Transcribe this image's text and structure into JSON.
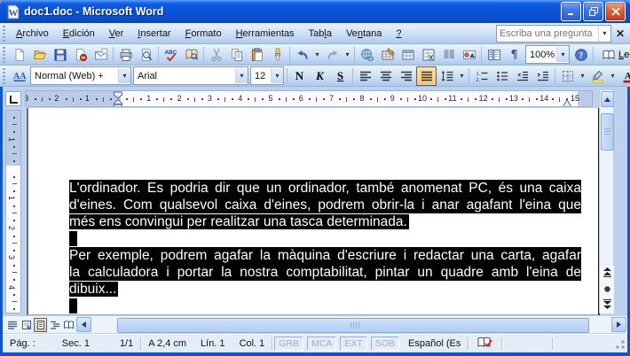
{
  "window": {
    "title": "doc1.doc - Microsoft Word"
  },
  "menubar": {
    "items": [
      {
        "pre": "",
        "key": "A",
        "post": "rchivo"
      },
      {
        "pre": "",
        "key": "E",
        "post": "dición"
      },
      {
        "pre": "",
        "key": "V",
        "post": "er"
      },
      {
        "pre": "",
        "key": "I",
        "post": "nsertar"
      },
      {
        "pre": "",
        "key": "F",
        "post": "ormato"
      },
      {
        "pre": "",
        "key": "H",
        "post": "erramientas"
      },
      {
        "pre": "Tab",
        "key": "l",
        "post": "a"
      },
      {
        "pre": "Ve",
        "key": "n",
        "post": "tana"
      },
      {
        "pre": "",
        "key": "?",
        "post": ""
      }
    ],
    "question_placeholder": "Escriba una pregunta"
  },
  "toolbar_standard": {
    "zoom_value": "100%",
    "read_label": {
      "pre": "",
      "key": "L",
      "post": "ectura"
    },
    "spelling_text": "ABC",
    "pilcrow": "¶",
    "icons": [
      "new-document",
      "open",
      "save",
      "permission",
      "email",
      "print",
      "print-preview",
      "spelling-grammar",
      "research",
      "cut",
      "copy",
      "paste",
      "format-painter",
      "undo",
      "redo",
      "insert-hyperlink",
      "tables-and-borders",
      "insert-table",
      "insert-excel-worksheet",
      "columns",
      "drawing",
      "document-map",
      "show-hide-paragraph",
      "zoom",
      "help",
      "read-layout",
      "toolbar-options"
    ]
  },
  "toolbar_format": {
    "styles_icon_text": "AA",
    "style_value": "Normal (Web) +",
    "font_value": "Arial",
    "size_value": "12",
    "bold_label": "N",
    "italic_label": "K",
    "underline_label": "S",
    "fontcolor_letter": "A",
    "icons": [
      "styles-and-formatting",
      "align-left",
      "align-center",
      "align-right",
      "justify",
      "line-spacing",
      "numbering",
      "bullets",
      "decrease-indent",
      "increase-indent",
      "borders",
      "highlight",
      "font-color",
      "toolbar-options"
    ],
    "active_button": "justify"
  },
  "ruler": {
    "h_margin_numbers": [
      "3",
      "2",
      "1"
    ],
    "h_numbers": [
      "1",
      "2",
      "3",
      "4",
      "5",
      "6",
      "7",
      "8",
      "9",
      "10",
      "11",
      "12",
      "13",
      "14"
    ],
    "h_end_number": "15",
    "v_margin_numbers": [
      "1"
    ],
    "v_numbers": [
      "1",
      "2",
      "3",
      "4"
    ]
  },
  "document": {
    "p1_lines": [
      "L'ordinador. Es podria dir que un ordinador, també anomenat PC, és una caixa",
      "d'eines. Com qualsevol caixa d'eines, podrem obrir-la i anar agafant l'eina que",
      "més ens convingui per realitzar una tasca determinada."
    ],
    "p2_lines": [
      "Per exemple, podrem agafar la màquina d'escriure i redactar una carta, agafar",
      "la calculadora i portar la nostra comptabilitat, pintar un quadre amb l'eina de",
      "dibuix..."
    ]
  },
  "statusbar": {
    "page": "Pág. :",
    "section": "Sec. 1",
    "page_of": "1/1",
    "vertical_position": "A 2,4 cm",
    "line": "Lín. 1",
    "column": "Col. 1",
    "toggles": [
      "GRB",
      "MCA",
      "EXT",
      "SOB"
    ],
    "language": "Español (Es"
  },
  "colors": {
    "titlebar_blue": "#0A51D0",
    "toolbar_blue": "#C6DAF5",
    "active_button_orange": "#FBC66F",
    "selection_bg": "#000000",
    "selection_fg": "#FFFFFF",
    "highlight_yellow": "#F3E83A",
    "fontcolor_red": "#CC1111"
  }
}
